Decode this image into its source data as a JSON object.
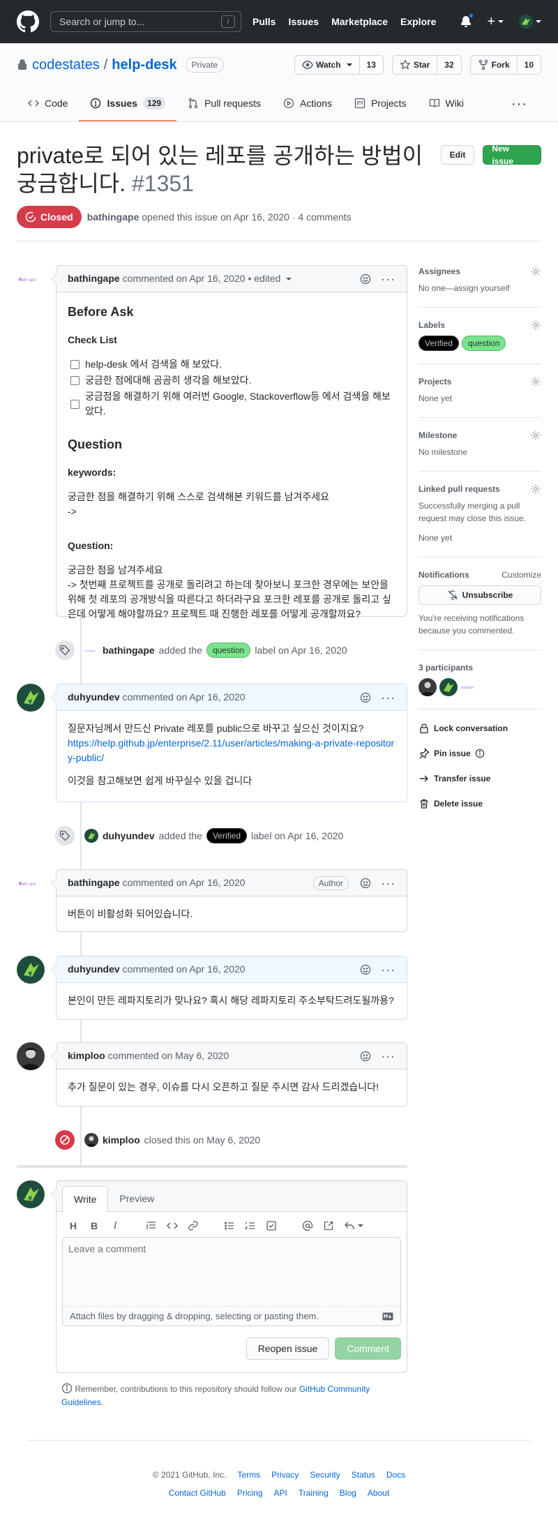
{
  "header": {
    "search_placeholder": "Search or jump to...",
    "search_key": "/",
    "nav": [
      "Pulls",
      "Issues",
      "Marketplace",
      "Explore"
    ]
  },
  "repo": {
    "owner": "codestates",
    "separator": "/",
    "name": "help-desk",
    "visibility": "Private",
    "watch_label": "Watch",
    "watch_count": "13",
    "star_label": "Star",
    "star_count": "32",
    "fork_label": "Fork",
    "fork_count": "10",
    "tabs": {
      "code": "Code",
      "issues": "Issues",
      "issues_count": "129",
      "pulls": "Pull requests",
      "actions": "Actions",
      "projects": "Projects",
      "wiki": "Wiki"
    }
  },
  "issue": {
    "title": "private로 되어 있는 레포를 공개하는 방법이 궁금합니다.",
    "number": "#1351",
    "edit_label": "Edit",
    "new_issue_label": "New issue",
    "state": "Closed",
    "author": "bathingape",
    "opened_text": "opened this issue on Apr 16, 2020 · 4 comments"
  },
  "comments": {
    "c1": {
      "author": "bathingape",
      "meta": "commented on Apr 16, 2020 • edited",
      "heading_before": "Before Ask",
      "heading_checklist": "Check List",
      "tasks": [
        "help-desk 에서 검색을 해 보았다.",
        "궁금한 점에대해 곰곰히 생각을 해보았다.",
        "궁금점을 해결하기 위해 여러번 Google, Stackoverflow등 에서 검색을 해보았다."
      ],
      "heading_question": "Question",
      "heading_keywords": "keywords:",
      "keywords_line1": "궁금한 점을 해결하기 위해 스스로 검색해본 키워드를 남겨주세요",
      "keywords_line2": "->",
      "heading_question2": "Question:",
      "question_line1": "궁금한 점을 남겨주세요",
      "question_line2": "-> 첫번째 프로젝트를 공개로 돌리려고 하는데 찾아보니 포크한 경우에는 보안을 위해 첫 레포의 공개방식을 따른다고 하더라구요 포크한 레포를 공개로 돌리고 싶은데 어떻게 해야할까요? 프로젝트 때 진행한 레포를 어떻게 공개할까요?"
    },
    "e1": {
      "actor": "bathingape",
      "pre": "added the",
      "label": "question",
      "post": "label on Apr 16, 2020"
    },
    "c2": {
      "author": "duhyundev",
      "meta": "commented on Apr 16, 2020",
      "line1": "질문자님께서 만드신 Private 레포를 public으로 바꾸고 싶으신 것이지요?",
      "link": "https://help.github.jp/enterprise/2.11/user/articles/making-a-private-repository-public/",
      "line2": "이것을 참고해보면 쉽게 바꾸실수 있을 겁니다"
    },
    "e2": {
      "actor": "duhyundev",
      "pre": "added the",
      "label": "Verified",
      "post": "label on Apr 16, 2020"
    },
    "c3": {
      "author": "bathingape",
      "meta": "commented on Apr 16, 2020",
      "badge": "Author",
      "body": "버튼이 비활성화 되어있습니다."
    },
    "c4": {
      "author": "duhyundev",
      "meta": "commented on Apr 16, 2020",
      "body": "본인이 만든 레파지토리가 맞나요? 혹시 해당 레파지토리 주소부탁드려도될까용?"
    },
    "c5": {
      "author": "kimploo",
      "meta": "commented on May 6, 2020",
      "body": "추가 질문이 있는 경우, 이슈를 다시 오픈하고 질문 주시면 감사 드리겠습니다!"
    },
    "e3": {
      "actor": "kimploo",
      "text": "closed this on May 6, 2020"
    }
  },
  "composer": {
    "tab_write": "Write",
    "tab_preview": "Preview",
    "placeholder": "Leave a comment",
    "attach_text": "Attach files by dragging & dropping, selecting or pasting them.",
    "reopen_label": "Reopen issue",
    "comment_label": "Comment",
    "guidelines_pre": "Remember, contributions to this repository should follow our",
    "guidelines_link": "GitHub Community Guidelines",
    "guidelines_post": "."
  },
  "sidebar": {
    "assignees_heading": "Assignees",
    "assignees_text": "No one—assign yourself",
    "labels_heading": "Labels",
    "labels": [
      "Verified",
      "question"
    ],
    "projects_heading": "Projects",
    "projects_text": "None yet",
    "milestone_heading": "Milestone",
    "milestone_text": "No milestone",
    "linked_heading": "Linked pull requests",
    "linked_text": "Successfully merging a pull request may close this issue.",
    "linked_none": "None yet",
    "notifications_heading": "Notifications",
    "customize_label": "Customize",
    "unsubscribe_label": "Unsubscribe",
    "notifications_text": "You're receiving notifications because you commented.",
    "participants_heading": "3 participants",
    "lock_label": "Lock conversation",
    "pin_label": "Pin issue",
    "transfer_label": "Transfer issue",
    "delete_label": "Delete issue"
  },
  "footer": {
    "copyright": "© 2021 GitHub, Inc.",
    "row1": [
      "Terms",
      "Privacy",
      "Security",
      "Status",
      "Docs"
    ],
    "row2": [
      "Contact GitHub",
      "Pricing",
      "API",
      "Training",
      "Blog",
      "About"
    ]
  },
  "colors": {
    "header_bg": "#24292e",
    "closed_red": "#d73a49",
    "green": "#2ea44f",
    "link_blue": "#0366d6",
    "tab_underline": "#f9826c"
  }
}
